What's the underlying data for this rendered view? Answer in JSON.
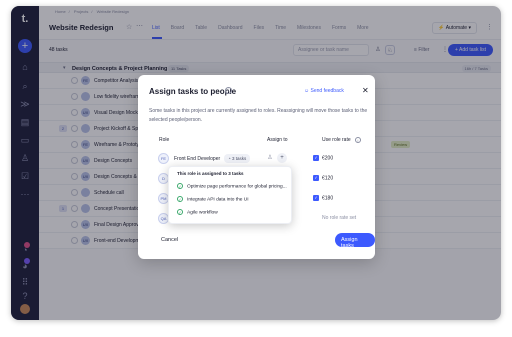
{
  "breadcrumb": [
    "Home",
    "Projects",
    "Website Redesign"
  ],
  "project_title": "Website Redesign",
  "tabs": [
    "List",
    "Board",
    "Table",
    "Dashboard",
    "Files",
    "Time",
    "Milestones",
    "Forms",
    "More"
  ],
  "automate_label": "Automate",
  "tasks_count": "48 tasks",
  "search_placeholder": "Assignee or task name",
  "filter_label": "Filter",
  "add_task_list_label": "Add task list",
  "group": {
    "title": "Design Concepts & Project Planning",
    "badge": "11 Tasks",
    "right": "16h / 7 Tasks"
  },
  "tasks": [
    {
      "name": "Competitor Analysis",
      "avatar": "FE"
    },
    {
      "name": "Low fidelity wireframes",
      "avatar": ""
    },
    {
      "name": "Visual Design Mockups",
      "avatar": "UX"
    },
    {
      "name": "Project Kickoff & Sprint",
      "avatar": "",
      "num": "2"
    },
    {
      "name": "Wireframe & Prototype",
      "avatar": "FE",
      "review": "Review"
    },
    {
      "name": "Design Concepts",
      "avatar": "UX"
    },
    {
      "name": "Design Concepts & Layout",
      "avatar": "UX"
    },
    {
      "name": "Schedule call",
      "avatar": ""
    },
    {
      "name": "Concept Presentation",
      "avatar": "",
      "num": "1"
    },
    {
      "name": "Final Design Approval",
      "avatar": "UX"
    },
    {
      "name": "Front-end Development & Responsive Design",
      "avatar": "UX",
      "meta": [
        "2",
        "0",
        "3"
      ]
    }
  ],
  "modal": {
    "title": "Assign tasks to people",
    "feedback": "Send feedback",
    "description": "Some tasks in this project are currently assigned to roles. Reassigning will move those tasks to the selected people/person.",
    "columns": [
      "Role",
      "Assign to",
      "Use role rate"
    ],
    "roles": [
      {
        "avatar": "FE",
        "name": "Front End Developer",
        "tasks": "3 tasks",
        "rate": "€200"
      },
      {
        "avatar": "D",
        "name": "",
        "tasks": "",
        "rate": "€120"
      },
      {
        "avatar": "PM",
        "name": "",
        "tasks": "",
        "rate": "€180"
      },
      {
        "avatar": "QA",
        "name": "",
        "tasks": "",
        "rate": "No role rate set"
      }
    ],
    "cancel_label": "Cancel",
    "assign_label": "Assign tasks"
  },
  "popover": {
    "title": "This role is assigned to 3 tasks",
    "items": [
      "Optimize page performance for global pricing...",
      "Integrate API data into the UI",
      "Agile workflow"
    ]
  },
  "colors": {
    "accent": "#3d5afe",
    "rail": "#1d1f3b"
  }
}
